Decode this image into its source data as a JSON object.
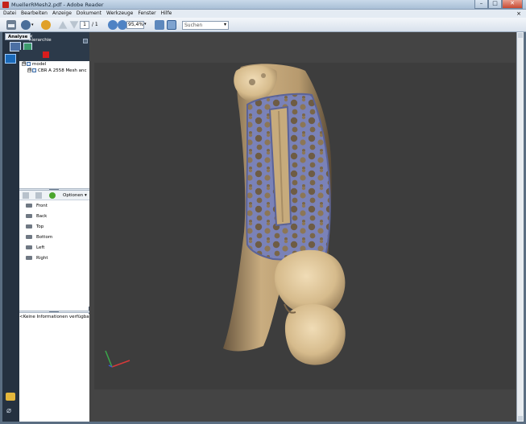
{
  "window": {
    "title": "MuellerRMesh2.pdf - Adobe Reader",
    "minimize": "–",
    "maximize": "□",
    "close": "✕"
  },
  "menu": {
    "items": [
      "Datei",
      "Bearbeiten",
      "Anzeige",
      "Dokument",
      "Werkzeuge",
      "Fenster",
      "Hilfe"
    ],
    "close": "×"
  },
  "toolbar": {
    "page_current": "1",
    "page_total": "/ 1",
    "zoom": "95,4%",
    "search_placeholder": "Suchen",
    "dropdown": "▾"
  },
  "panel": {
    "tab_label": "Analyse",
    "tab_close": "×",
    "title": "hierarchie",
    "tree": [
      {
        "label": "model",
        "expander": "⊟"
      },
      {
        "label": "CBR A 2558 Mesh anc",
        "expander": "⊟"
      }
    ],
    "options_label": "Optionen ▾",
    "views": [
      "Front",
      "Back",
      "Top",
      "Bottom",
      "Left",
      "Right"
    ],
    "info": "<Keine Informationen verfügbar>"
  },
  "colors": {
    "viewer_bg": "#444444",
    "bone": "#e2c9a0",
    "mesh": "#7a82b8"
  }
}
